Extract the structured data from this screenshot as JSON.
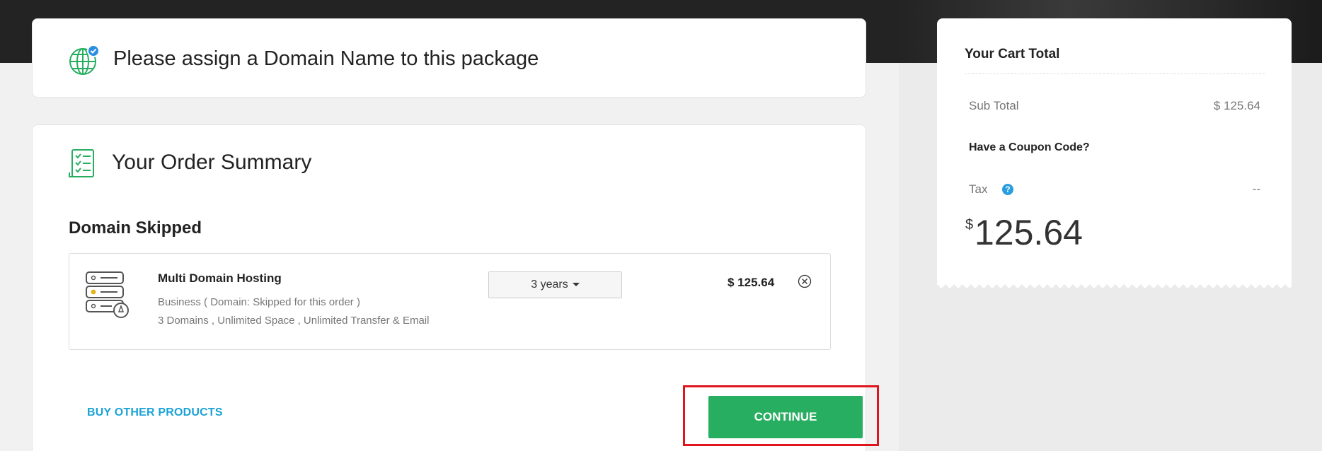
{
  "domain_section": {
    "title": "Please assign a Domain Name to this package"
  },
  "order_summary": {
    "title": "Your Order Summary",
    "subtitle": "Domain Skipped",
    "item": {
      "name": "Multi Domain Hosting",
      "description": "Business ( Domain: Skipped for this order )",
      "features": "3 Domains , Unlimited Space , Unlimited Transfer & Email",
      "term": "3 years",
      "price": "$ 125.64"
    },
    "buy_other_label": "BUY OTHER PRODUCTS",
    "continue_label": "CONTINUE"
  },
  "cart": {
    "title": "Your Cart Total",
    "subtotal_label": "Sub Total",
    "subtotal_value": "$ 125.64",
    "coupon_label": "Have a Coupon Code?",
    "tax_label": "Tax",
    "tax_help": "?",
    "tax_value": "--",
    "total_currency": "$",
    "total_amount": "125.64"
  },
  "colors": {
    "accent_green": "#27ae60",
    "link_blue": "#1ba3d6",
    "highlight_red": "#e0141c",
    "help_blue": "#2a9ddf"
  },
  "icons": [
    "globe-check-icon",
    "checklist-icon",
    "server-icon",
    "remove-circle-icon",
    "caret-down-icon",
    "help-icon"
  ]
}
